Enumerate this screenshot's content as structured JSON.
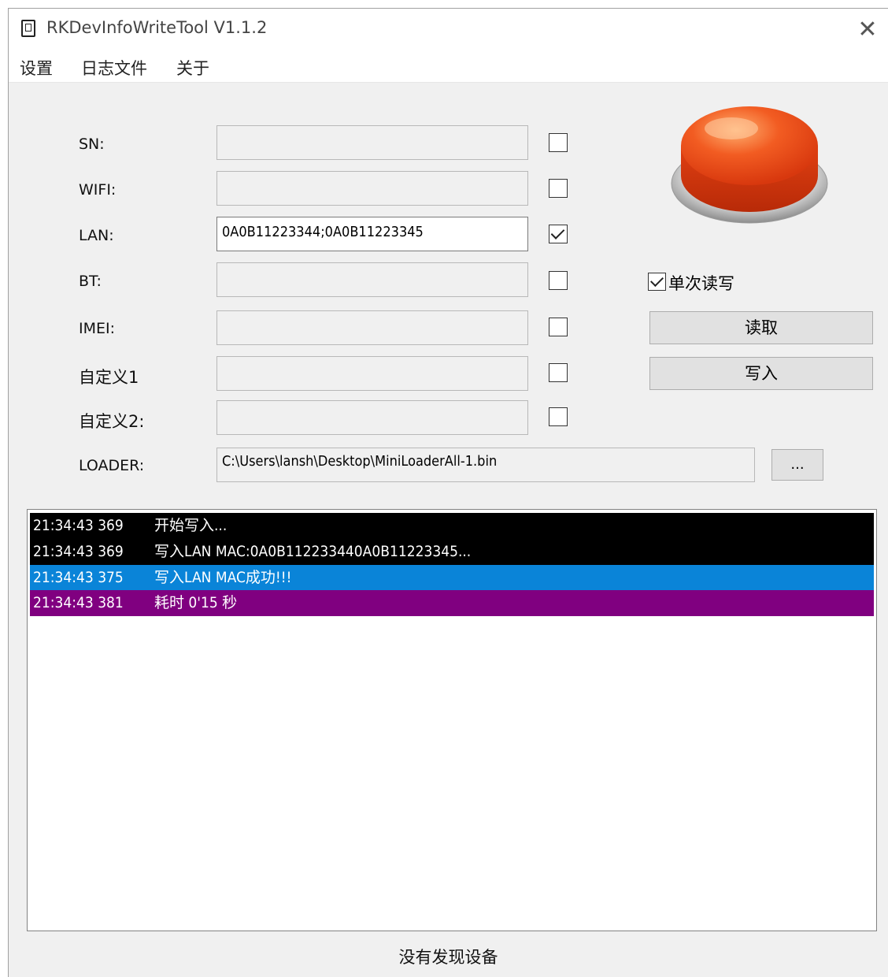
{
  "window": {
    "title": "RKDevInfoWriteTool V1.1.2",
    "close_glyph": "✕"
  },
  "menu": [
    "设置",
    "日志文件",
    "关于"
  ],
  "fields": [
    {
      "label": "SN:",
      "value": "",
      "checked": false
    },
    {
      "label": "WIFI:",
      "value": "",
      "checked": false
    },
    {
      "label": "LAN:",
      "value": "0A0B11223344;0A0B11223345",
      "checked": true
    },
    {
      "label": "BT:",
      "value": "",
      "checked": false
    },
    {
      "label": "IMEI:",
      "value": "",
      "checked": false
    },
    {
      "label": "自定义1",
      "value": "",
      "checked": false
    },
    {
      "label": "自定义2:",
      "value": "",
      "checked": false
    }
  ],
  "loader": {
    "label": "LOADER:",
    "path": "C:\\Users\\lansh\\Desktop\\MiniLoaderAll-1.bin",
    "browse_label": "..."
  },
  "controls": {
    "single_rw_label": "单次读写",
    "single_rw_checked": true,
    "read_label": "读取",
    "write_label": "写入"
  },
  "log": [
    {
      "time": "21:34:43 369",
      "message": "开始写入...",
      "style": "black"
    },
    {
      "time": "21:34:43 369",
      "message": "写入LAN MAC:0A0B112233440A0B11223345...",
      "style": "black"
    },
    {
      "time": "21:34:43 375",
      "message": "写入LAN MAC成功!!!",
      "style": "blue"
    },
    {
      "time": "21:34:43 381",
      "message": "耗时 0'15 秒",
      "style": "purple"
    }
  ],
  "status": "没有发现设备",
  "colors": {
    "log_black": "#000000",
    "log_blue": "#0a84d8",
    "log_purple": "#800080",
    "big_button": "#e8401a"
  },
  "icons": {
    "app": "phone-icon",
    "big_button": "red-push-button-icon"
  }
}
